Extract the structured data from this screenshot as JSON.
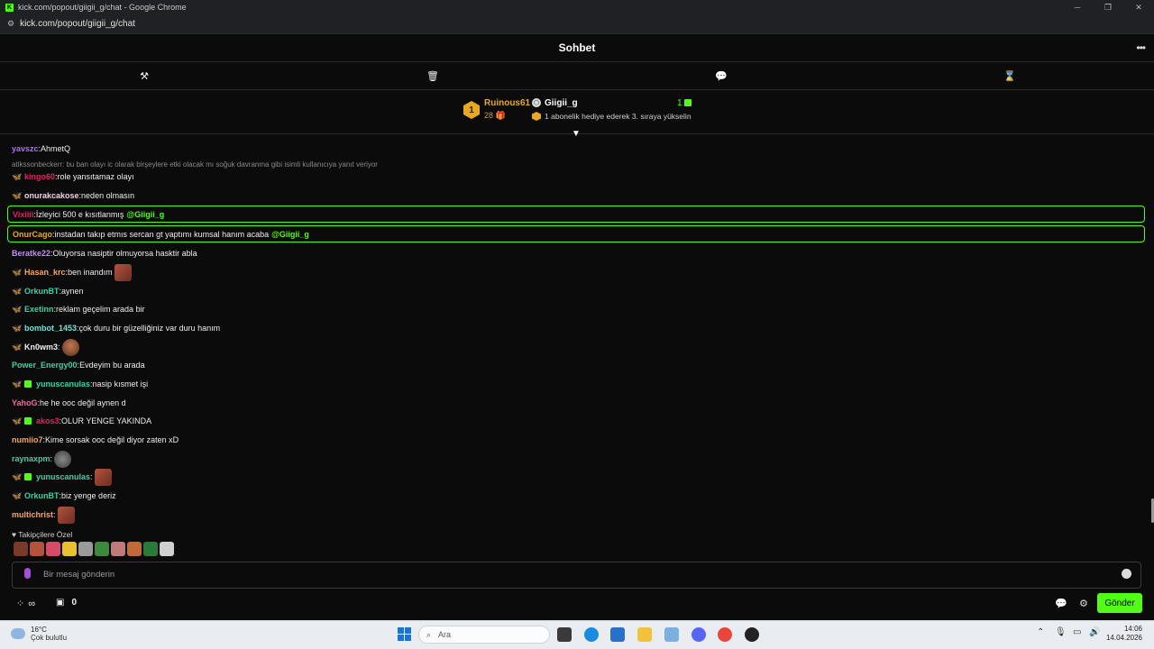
{
  "browser": {
    "window_title": "kick.com/popout/giigii_g/chat - Google Chrome",
    "url": "kick.com/popout/giigii_g/chat",
    "favicon_letter": "K"
  },
  "chat": {
    "header_title": "Sohbet",
    "more_icon": "ellipsis-icon"
  },
  "mod_toolbar": {
    "items": [
      {
        "name": "ban-hammer-icon",
        "glyph": "⚒"
      },
      {
        "name": "trash-icon",
        "glyph": "🗑"
      },
      {
        "name": "chat-bubble-icon",
        "glyph": "💬"
      },
      {
        "name": "hourglass-icon",
        "glyph": "⌛"
      }
    ]
  },
  "pinned": {
    "rank": "1",
    "gifter_name": "Ruinous61",
    "gifter_count": "28",
    "target_name": "Giigii_g",
    "target_count": "1",
    "hint": "1 abonelik hediye ederek 3. sıraya yükselin"
  },
  "messages": [
    {
      "user": "yavszc",
      "color": "#b06cff",
      "text": "AhmetQ",
      "badges": []
    },
    {
      "reply_to": "atikssonbeckerr: bu ban olayı ic olarak birşeylere etki olacak mı soğuk davranma gibi isimli kullanıcıya yanıt veriyor"
    },
    {
      "user": "kingo60",
      "color": "#e0245e",
      "text": "role yansıtamaz olayı",
      "badges": [
        "gold-fly"
      ]
    },
    {
      "user": "onurakcakose",
      "color": "#f2d3e4",
      "text": "neden olmasın",
      "badges": [
        "gold-fly"
      ]
    },
    {
      "user": "Vixiiii",
      "color": "#e0245e",
      "text": "İzleyici 500 e kısıtlanmış",
      "mention": "@Giigii_g",
      "highlight": true,
      "badges": []
    },
    {
      "user": "OnurCago",
      "color": "#e7a72a",
      "text": "instadan takıp etmıs sercan gt yaptımı kumsal hanım acaba",
      "mention": "@Giigii_g",
      "highlight": true,
      "badges": []
    },
    {
      "user": "Beratke22",
      "color": "#c58cf6",
      "text": "Oluyorsa nasiptir olmuyorsa hasktir abla",
      "badges": []
    },
    {
      "user": "Hasan_krc",
      "color": "#f5a85e",
      "text": "ben inandım",
      "badges": [
        "fly"
      ],
      "emote": "emote"
    },
    {
      "user": "OrkunBT",
      "color": "#3fd0a4",
      "text": "aynen",
      "badges": [
        "fly"
      ]
    },
    {
      "user": "Exetinn",
      "color": "#3fd0a4",
      "text": "reklam geçelim arada bir",
      "badges": [
        "fly"
      ]
    },
    {
      "user": "bombot_1453",
      "color": "#73e3d8",
      "text": "çok duru bir güzelliğiniz var duru hanım",
      "badges": [
        "fly"
      ]
    },
    {
      "user": "Kn0wm3",
      "color": "#f2f2f2",
      "text": "",
      "badges": [
        "fly"
      ],
      "emote": "face"
    },
    {
      "user": "Power_Energy00",
      "color": "#3fd0a4",
      "text": "Evdeyim bu arada",
      "badges": []
    },
    {
      "user": "yunuscanulas",
      "color": "#3fd0a4",
      "text": "nasip kısmet işi",
      "badges": [
        "fly",
        "sub"
      ]
    },
    {
      "user": "YahoG",
      "color": "#f06aa0",
      "text": "he he ooc değil aynen d",
      "badges": []
    },
    {
      "user": "akos3",
      "color": "#e0245e",
      "text": "OLUR YENGE YAKINDA",
      "badges": [
        "fly",
        "sub"
      ]
    },
    {
      "user": "numiio7",
      "color": "#f5a85e",
      "text": "Kime sorsak ooc değil diyor zaten xD",
      "badges": []
    },
    {
      "user": "raynaxpm",
      "color": "#3fd0a4",
      "text": "",
      "badges": [],
      "emote": "grey"
    },
    {
      "user": "yunuscanulas",
      "color": "#3fd0a4",
      "text": "",
      "badges": [
        "fly",
        "sub"
      ],
      "emote": "emote"
    },
    {
      "user": "OrkunBT",
      "color": "#3fd0a4",
      "text": "biz yenge deriz",
      "badges": [
        "fly"
      ]
    },
    {
      "user": "multichrist",
      "color": "#f5a85e",
      "text": "",
      "badges": [],
      "emote": "emote"
    }
  ],
  "followers_emotes": {
    "label": "Takipçilere Özel",
    "colors": [
      "#7a3a2a",
      "#b5523c",
      "#d84a6a",
      "#e8c030",
      "#9a9a9a",
      "#3c8a3c",
      "#c07a7a",
      "#c06a3a",
      "#2a7a3a",
      "#d0d0d0"
    ]
  },
  "input": {
    "placeholder": "Bir mesaj gönderin"
  },
  "bottom": {
    "store_count": "0",
    "send_label": "Gönder",
    "accent": "#53fc18"
  },
  "taskbar": {
    "temp": "16°C",
    "weather": "Çok bulutlu",
    "search_placeholder": "Ara",
    "time": "14:06",
    "date": "14.04.2026"
  }
}
